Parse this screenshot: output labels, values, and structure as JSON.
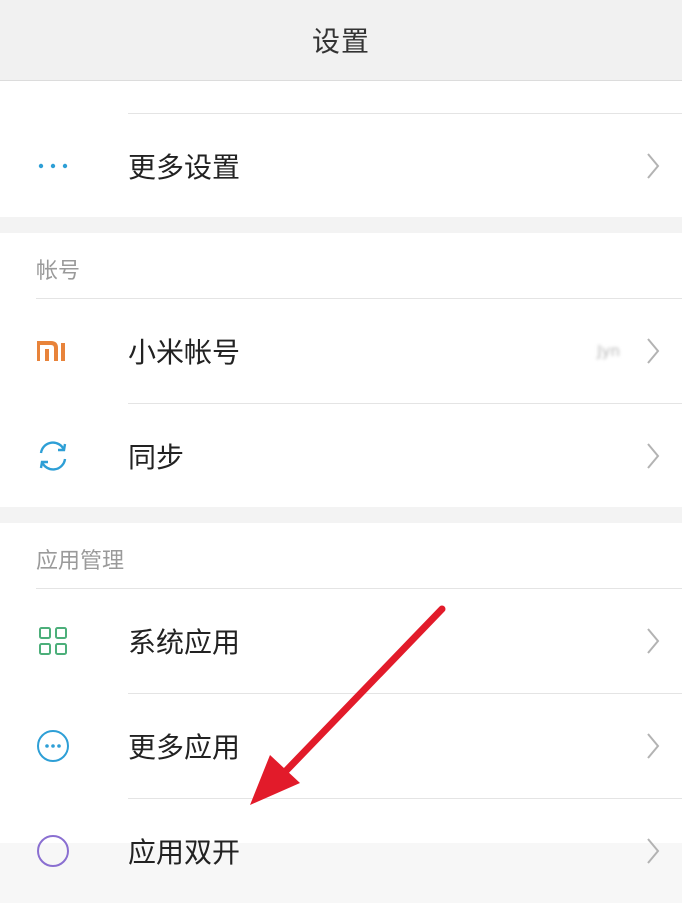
{
  "header": {
    "title": "设置"
  },
  "sections": {
    "top": {
      "more_settings": {
        "label": "更多设置",
        "icon": "more-dots-icon"
      }
    },
    "account": {
      "header": "帐号",
      "mi_account": {
        "label": "小米帐号",
        "value": "Jyn",
        "icon": "mi-logo-icon"
      },
      "sync": {
        "label": "同步",
        "icon": "sync-icon"
      }
    },
    "apps": {
      "header": "应用管理",
      "system_apps": {
        "label": "系统应用",
        "icon": "grid-icon"
      },
      "more_apps": {
        "label": "更多应用",
        "icon": "more-circle-icon"
      },
      "app_lock": {
        "label": "应用双开",
        "icon": "circle-icon"
      }
    }
  },
  "colors": {
    "accent_blue": "#2e9fd6",
    "mi_orange": "#e8833a",
    "grid_green": "#4caf7a",
    "arrow_red": "#e21b2a"
  }
}
